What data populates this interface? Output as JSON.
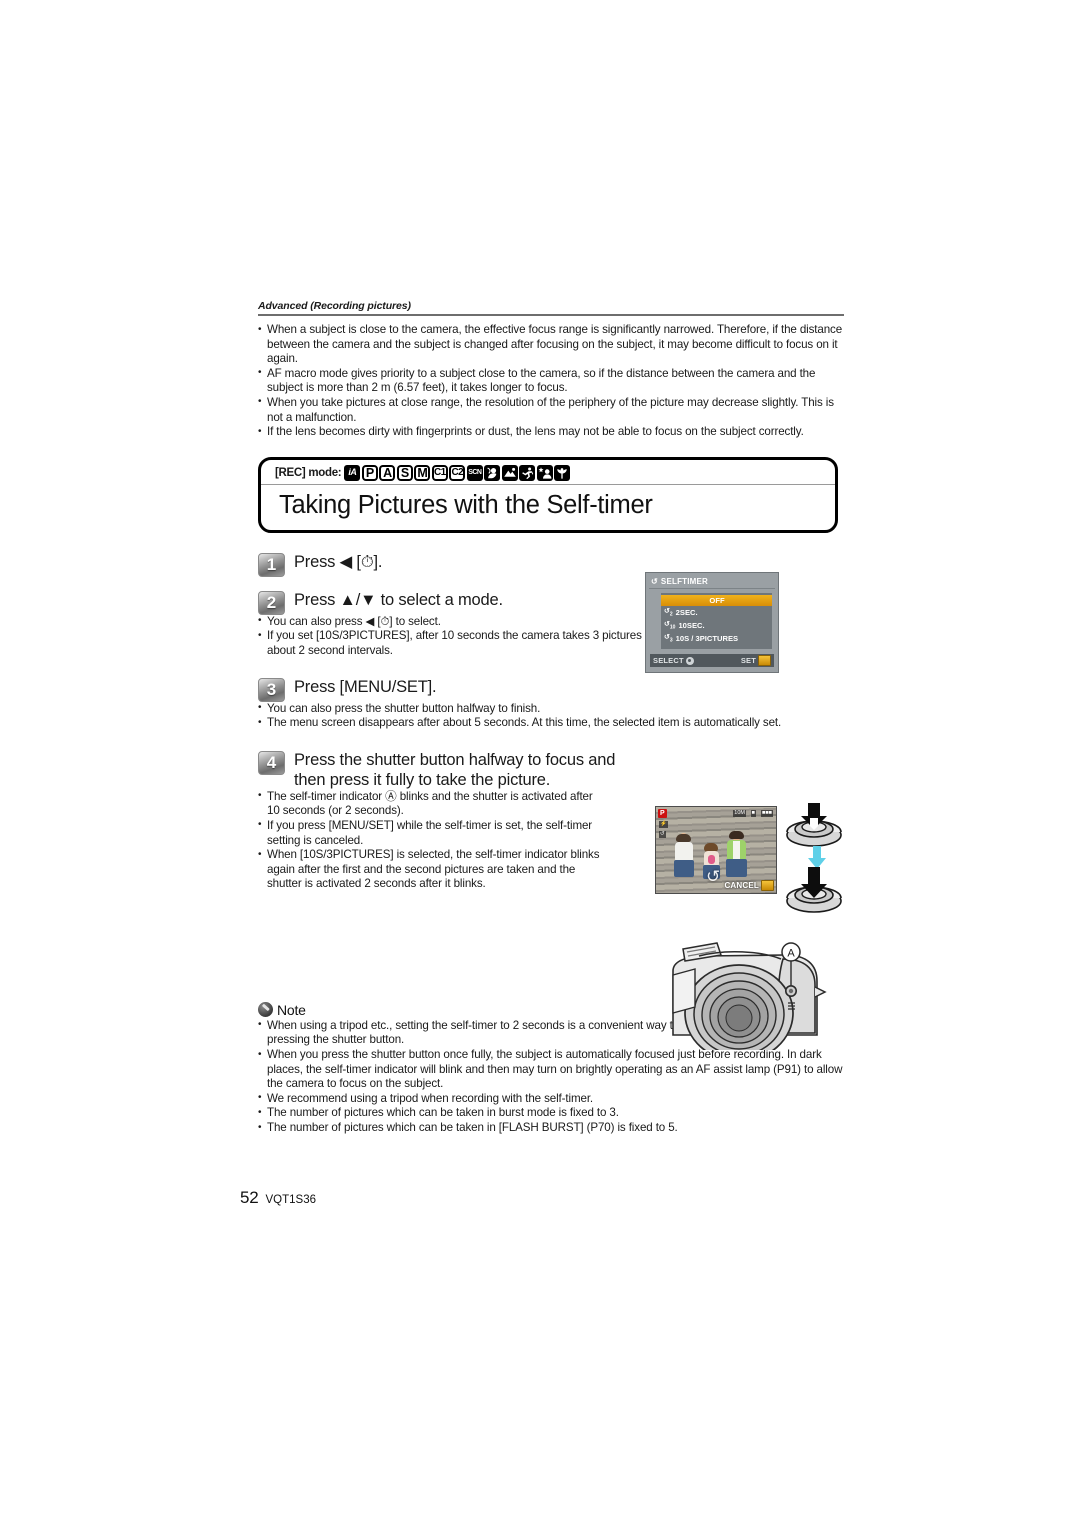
{
  "running_head": "Advanced (Recording pictures)",
  "intro_bullets": [
    "When a subject is close to the camera, the effective focus range is significantly narrowed. Therefore, if the distance between the camera and the subject is changed after focusing on the subject, it may become difficult to focus on it again.",
    "AF macro mode gives priority to a subject close to the camera, so if the distance between the camera and the subject is more than 2 m (6.57 feet), it takes longer to focus.",
    "When you take pictures at close range, the resolution of the periphery of the picture may decrease slightly. This is not a malfunction.",
    "If the lens becomes dirty with fingerprints or dust, the lens may not be able to focus on the subject correctly."
  ],
  "title_block": {
    "rec_mode_label": "[REC] mode:",
    "mode_icons": [
      {
        "name": "intelligent-auto-mode-icon",
        "text": "iA"
      },
      {
        "name": "program-ae-mode-icon",
        "text": "P"
      },
      {
        "name": "aperture-priority-mode-icon",
        "text": "A"
      },
      {
        "name": "shutter-priority-mode-icon",
        "text": "S"
      },
      {
        "name": "manual-exposure-mode-icon",
        "text": "M"
      },
      {
        "name": "custom-1-mode-icon",
        "text": "C1"
      },
      {
        "name": "custom-2-mode-icon",
        "text": "C2"
      },
      {
        "name": "scene-mode-icon",
        "text": "SCN"
      },
      {
        "name": "portrait-mode-icon",
        "text": ""
      },
      {
        "name": "scenery-mode-icon",
        "text": ""
      },
      {
        "name": "sports-mode-icon",
        "text": ""
      },
      {
        "name": "night-portrait-mode-icon",
        "text": ""
      },
      {
        "name": "close-up-mode-icon",
        "text": ""
      }
    ],
    "heading": "Taking Pictures with the Self-timer"
  },
  "steps": [
    {
      "number": "1",
      "text": "Press ◀ [⏱].",
      "substeps": []
    },
    {
      "number": "2",
      "text": "Press ▲/▼ to select a mode.",
      "substeps": [
        "You can also press ◀ [⏱] to select.",
        "If you set [10S/3PICTURES], after 10 seconds the camera takes 3 pictures at about 2 second intervals."
      ]
    },
    {
      "number": "3",
      "text": "Press [MENU/SET].",
      "substeps": [
        "You can also press the shutter button halfway to finish.",
        "The menu screen disappears after about 5 seconds. At this time, the selected item is automatically set."
      ]
    },
    {
      "number": "4",
      "text": "Press the shutter button halfway to focus and then press it fully to take the picture.",
      "substeps": [
        "The self-timer indicator Ⓐ blinks and the shutter is activated after 10 seconds (or 2 seconds).",
        "If you press [MENU/SET] while the self-timer is set, the self-timer setting is canceled.",
        "When [10S/3PICTURES] is selected, the self-timer indicator blinks again after the first and the second pictures are taken and the shutter is activated 2 seconds after it blinks."
      ]
    }
  ],
  "selftimer_menu": {
    "title": "SELFTIMER",
    "items": [
      {
        "label": "OFF",
        "selected": true
      },
      {
        "label": "2SEC.",
        "selected": false
      },
      {
        "label": "10SEC.",
        "selected": false
      },
      {
        "label": "10S / 3PICTURES",
        "selected": false
      }
    ],
    "footer_select": "SELECT",
    "footer_set": "SET"
  },
  "lcd_photo": {
    "mode_badge": "P",
    "cancel_label": "CANCEL"
  },
  "camera_figure": {
    "callout_label": "A"
  },
  "note": {
    "title": "Note",
    "bullets": [
      "When using a tripod etc., setting the self-timer to 2 seconds is a convenient way to avoid the jitter caused by pressing the shutter button.",
      "When you press the shutter button once fully, the subject is automatically focused just before recording. In dark places, the self-timer indicator will blink and then may turn on brightly operating as an AF assist lamp (P91) to allow the camera to focus on the subject.",
      "We recommend using a tripod when recording with the self-timer.",
      "The number of pictures which can be taken in burst mode is fixed to 3.",
      "The number of pictures which can be taken in [FLASH BURST] (P70) is fixed to 5."
    ]
  },
  "footer": {
    "page_number": "52",
    "doc_number": "VQT1S36"
  },
  "colors": {
    "accent_yellow": "#e0a010",
    "lcd_gray": "#9aa0a4",
    "flow_arrow": "#5fd0e8",
    "rule_gray": "#6e6e6e"
  }
}
